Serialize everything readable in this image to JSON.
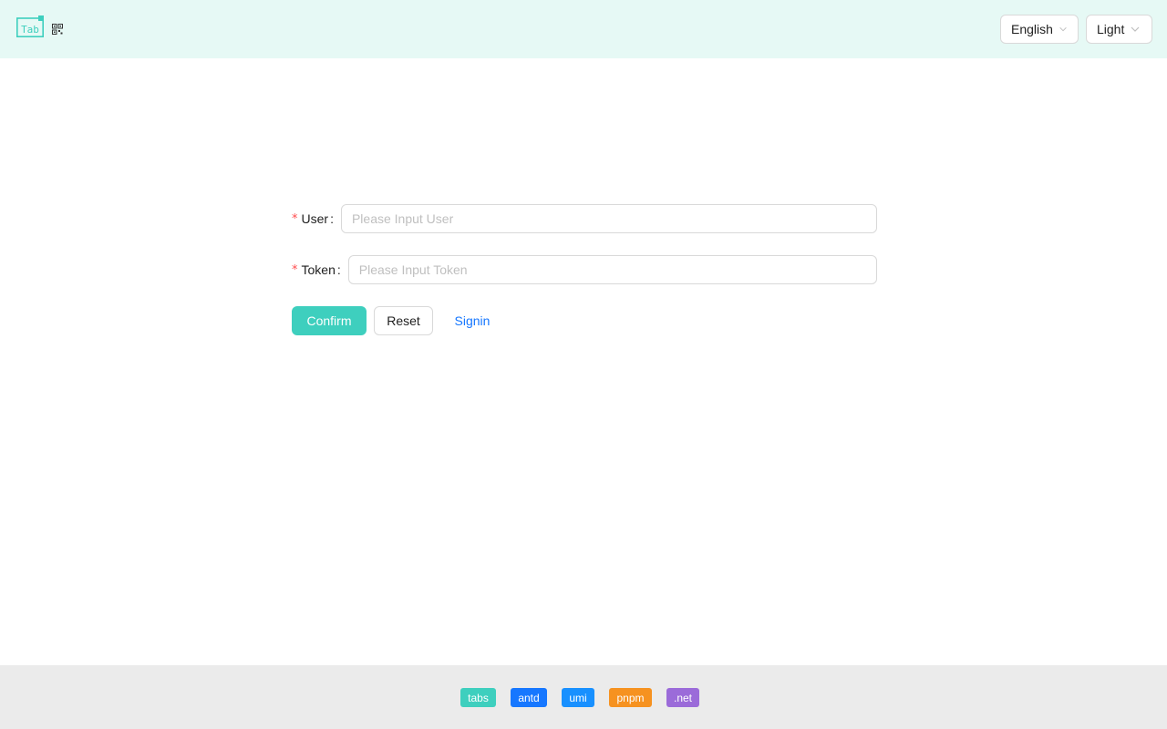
{
  "header": {
    "logo_text": "Tab",
    "language_select": {
      "value": "English"
    },
    "theme_select": {
      "value": "Light"
    }
  },
  "form": {
    "user": {
      "label": "User",
      "placeholder": "Please Input User",
      "value": ""
    },
    "token": {
      "label": "Token",
      "placeholder": "Please Input Token",
      "value": ""
    },
    "required_mark": "*",
    "colon": ":",
    "confirm_label": "Confirm",
    "reset_label": "Reset",
    "signin_label": "Signin"
  },
  "footer": {
    "tags": [
      {
        "label": "tabs",
        "color": "#3ecfbe"
      },
      {
        "label": "antd",
        "color": "#1677ff"
      },
      {
        "label": "umi",
        "color": "#1890ff"
      },
      {
        "label": "pnpm",
        "color": "#f69220"
      },
      {
        "label": ".net",
        "color": "#9b6bd9"
      }
    ]
  },
  "colors": {
    "header_bg": "#e6f9f5",
    "primary": "#3ecfbe",
    "link": "#1677ff",
    "required": "#ff4d4f",
    "footer_bg": "#ebebeb"
  }
}
